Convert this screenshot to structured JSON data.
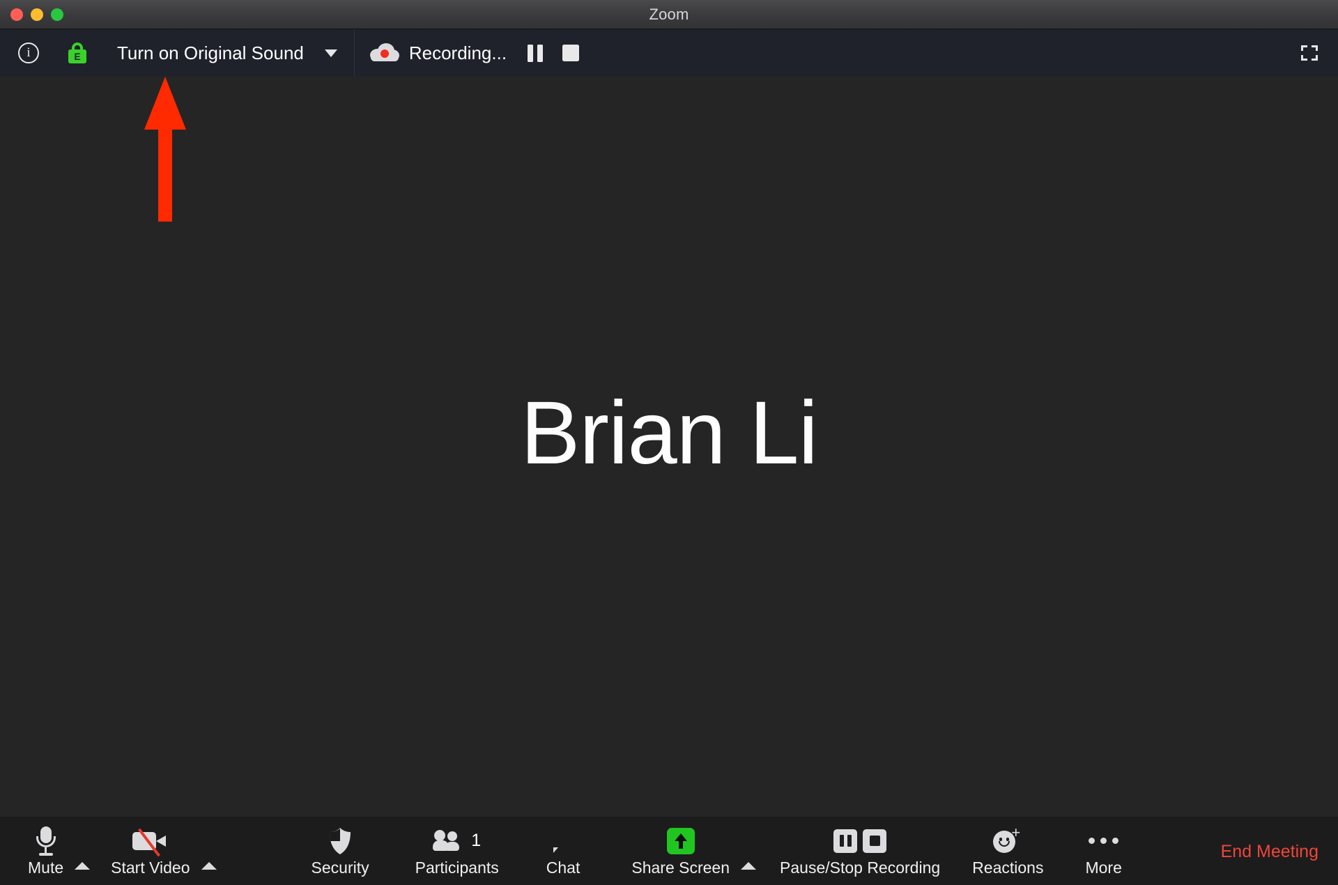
{
  "window": {
    "title": "Zoom",
    "traffic_lights": [
      "close",
      "minimize",
      "maximize"
    ],
    "colors": {
      "close": "#ff5f57",
      "minimize": "#febc2e",
      "maximize": "#28c840",
      "titlebar": "#3a3a3c",
      "topbar": "#1f222b",
      "stage": "#252525",
      "bottombar": "#1c1c1c",
      "accent_green": "#21c521",
      "accent_red": "#f0453a",
      "annotation_red": "#ff2a00"
    }
  },
  "topbar": {
    "info_icon": "info-icon",
    "encryption_icon": "green-lock-icon",
    "encryption_letter": "E",
    "original_sound_label": "Turn on Original Sound",
    "original_sound_caret": "chevron-down-icon",
    "recording": {
      "cloud_icon": "cloud-recording-icon",
      "label": "Recording...",
      "pause_icon": "pause-icon",
      "stop_icon": "stop-icon"
    },
    "fullscreen_icon": "fullscreen-icon"
  },
  "annotation": {
    "type": "arrow",
    "direction": "up",
    "color": "#ff2a00",
    "points_to": "Turn on Original Sound"
  },
  "stage": {
    "speaker_name": "Brian Li"
  },
  "bottombar": {
    "items": [
      {
        "id": "mute",
        "label": "Mute",
        "icon": "microphone-icon",
        "has_chevron": true
      },
      {
        "id": "video",
        "label": "Start Video",
        "icon": "video-off-icon",
        "has_chevron": true
      },
      {
        "id": "security",
        "label": "Security",
        "icon": "shield-icon",
        "has_chevron": false
      },
      {
        "id": "participants",
        "label": "Participants",
        "icon": "people-icon",
        "has_chevron": false,
        "badge": "1"
      },
      {
        "id": "chat",
        "label": "Chat",
        "icon": "chat-bubble-icon",
        "has_chevron": false
      },
      {
        "id": "share",
        "label": "Share Screen",
        "icon": "share-screen-icon",
        "has_chevron": true
      },
      {
        "id": "recording",
        "label": "Pause/Stop Recording",
        "icon": "pause-stop-recording-icon",
        "has_chevron": false
      },
      {
        "id": "reactions",
        "label": "Reactions",
        "icon": "reactions-icon",
        "has_chevron": false
      },
      {
        "id": "more",
        "label": "More",
        "icon": "ellipsis-icon",
        "has_chevron": false
      }
    ],
    "end_meeting_label": "End Meeting"
  }
}
